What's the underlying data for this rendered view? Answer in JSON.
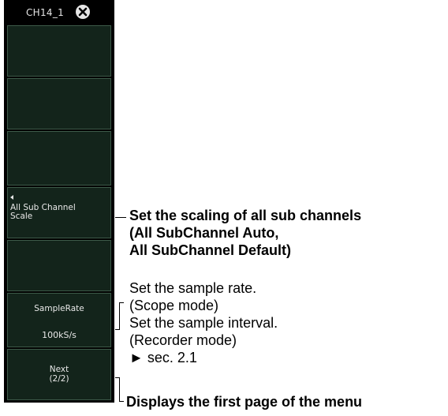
{
  "panel": {
    "title": "CH14_1",
    "close_icon": "close-icon",
    "softkeys": {
      "all_sub_channel_scale": {
        "line1": "All Sub Channel",
        "line2": "Scale"
      },
      "sample_rate": {
        "label": "SampleRate",
        "value": "100kS/s"
      },
      "next": {
        "line1": "Next",
        "line2": "(2/2)"
      }
    }
  },
  "annotations": {
    "scale": {
      "line1": "Set the scaling of all sub channels",
      "line2": "(All SubChannel Auto,",
      "line3": "All SubChannel Default)"
    },
    "sample": {
      "line1": "Set the sample rate.",
      "line2": "(Scope mode)",
      "line3": "Set the sample interval.",
      "line4": "(Recorder mode)",
      "line5": "► sec. 2.1"
    },
    "next": {
      "line1": "Displays the first page of the menu"
    }
  }
}
